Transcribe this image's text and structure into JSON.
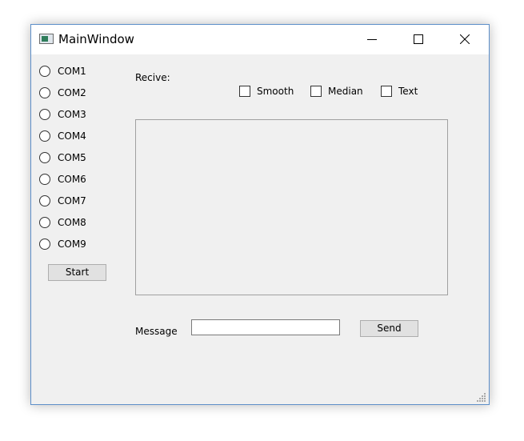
{
  "window": {
    "title": "MainWindow",
    "controls": {
      "minimize_icon": "minimize-icon",
      "maximize_icon": "maximize-icon",
      "close_icon": "close-icon"
    }
  },
  "ports": [
    {
      "label": "COM1"
    },
    {
      "label": "COM2"
    },
    {
      "label": "COM3"
    },
    {
      "label": "COM4"
    },
    {
      "label": "COM5"
    },
    {
      "label": "COM6"
    },
    {
      "label": "COM7"
    },
    {
      "label": "COM8"
    },
    {
      "label": "COM9"
    }
  ],
  "start_button": "Start",
  "receive": {
    "label": "Recive:",
    "options": [
      {
        "label": "Smooth"
      },
      {
        "label": "Median"
      },
      {
        "label": "Text"
      }
    ]
  },
  "message": {
    "label": "Message",
    "value": "",
    "send_button": "Send"
  },
  "colors": {
    "window_border": "#5d8fc9",
    "client_background": "#f0f0f0",
    "button_background": "#e1e1e1"
  }
}
